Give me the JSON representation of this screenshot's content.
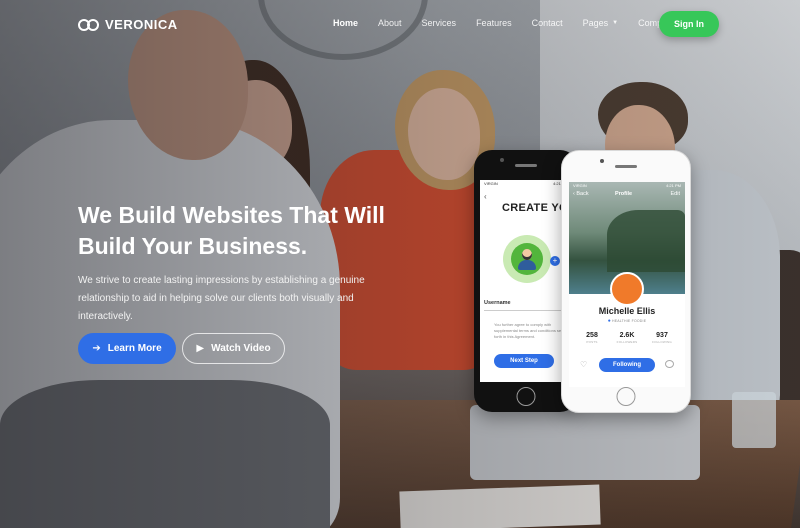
{
  "brand": {
    "name": "VERONICA"
  },
  "nav": {
    "items": [
      {
        "label": "Home",
        "active": true,
        "dropdown": false
      },
      {
        "label": "About",
        "active": false,
        "dropdown": false
      },
      {
        "label": "Services",
        "active": false,
        "dropdown": false
      },
      {
        "label": "Features",
        "active": false,
        "dropdown": false
      },
      {
        "label": "Contact",
        "active": false,
        "dropdown": false
      },
      {
        "label": "Pages",
        "active": false,
        "dropdown": true
      },
      {
        "label": "Component",
        "active": false,
        "dropdown": true
      }
    ],
    "signin_label": "Sign In"
  },
  "hero": {
    "title": "We Build Websites That Will Build Your Business.",
    "subtitle": "We strive to create lasting impressions by establishing a genuine relationship to aid in helping solve our clients both visually and interactively.",
    "primary_button": "Learn More",
    "secondary_button": "Watch Video"
  },
  "phone_left": {
    "status_left": "VIRGIN",
    "status_time": "4:21 PM",
    "title": "CREATE YOUR ACCOUNT",
    "field_label": "Username",
    "terms_text": "You further agree to comply with supplemental terms and conditions set forth in this Agreement.",
    "next_button": "Next Step"
  },
  "phone_right": {
    "status_left": "VIRGIN",
    "status_time": "4:21 PM",
    "back_label": "Back",
    "header_title": "Profile",
    "edit_label": "Edit",
    "name": "Michelle Ellis",
    "location": "HEALTHIE FOODIE",
    "stats": [
      {
        "value": "258",
        "label": "POSTS"
      },
      {
        "value": "2.6K",
        "label": "FOLLOWERS"
      },
      {
        "value": "937",
        "label": "FOLLOWING"
      }
    ],
    "follow_button": "Following"
  },
  "colors": {
    "primary_blue": "#2f6ee6",
    "signin_green": "#37c759",
    "dress_red": "#d94a2a"
  }
}
